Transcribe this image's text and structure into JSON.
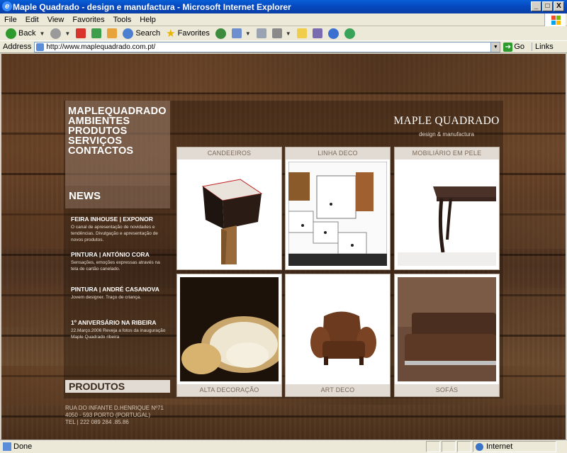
{
  "window": {
    "title": "Maple Quadrado - design e manufactura - Microsoft Internet Explorer",
    "min_label": "_",
    "max_label": "□",
    "close_label": "X"
  },
  "menu": [
    "File",
    "Edit",
    "View",
    "Favorites",
    "Tools",
    "Help"
  ],
  "toolbar": {
    "back_label": "Back",
    "search_label": "Search",
    "favorites_label": "Favorites"
  },
  "address": {
    "label": "Address",
    "url": "http://www.maplequadrado.com.pt/",
    "go_label": "Go",
    "links_label": "Links"
  },
  "site": {
    "brand_name": "MAPLE QUADRADO",
    "brand_sub": "design & manufactura",
    "nav": [
      "MAPLEQUADRADO",
      "AMBIENTES",
      "PRODUTOS",
      "SERVIÇOS",
      "CONTACTOS"
    ],
    "news_title": "NEWS",
    "news": [
      {
        "title": "FEIRA INHOUSE | EXPONOR",
        "text": "O canal de apresentação de novidades e tendências. Divulgação e apresentação de novos produtos."
      },
      {
        "title": "PINTURA | ANTÓNIO CORA",
        "text": "Sensações, emoções expressas através na tela de cartão canelado."
      },
      {
        "title": "PINTURA | ANDRÉ CASANOVA",
        "text": "Jovem designer. Traço de criança."
      },
      {
        "title": "1º ANIVERSÁRIO NA RIBEIRA",
        "text": "22.Março.2006 Reveja a fotos da inauguração Maple Quadrado ribeira"
      }
    ],
    "tiles_top": [
      "CANDEEIROS",
      "LINHA DECO",
      "MOBILIÁRIO EM PELE"
    ],
    "tiles_bottom": [
      "ALTA DECORAÇÃO",
      "ART DECO",
      "SOFÁS"
    ],
    "produtos_label": "PRODUTOS",
    "address_lines": [
      "RUA DO INFANTE D.HENRIQUE Nº71",
      "4050 - 593 PORTO (PORTUGAL)",
      "TEL | 222 089 284 .85.86"
    ]
  },
  "status": {
    "text": "Done",
    "zone": "Internet"
  }
}
